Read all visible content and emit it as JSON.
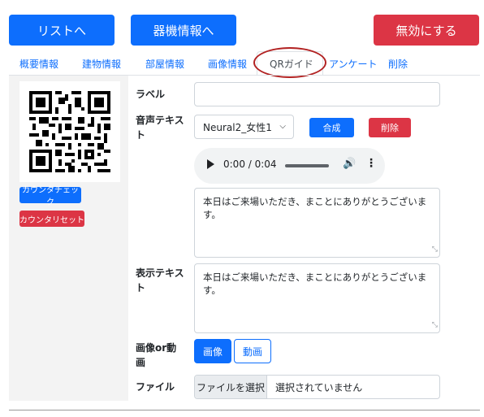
{
  "header": {
    "list_button": "リストへ",
    "device_button": "器機情報へ",
    "disable_button": "無効にする"
  },
  "tabs": [
    {
      "label": "概要情報"
    },
    {
      "label": "建物情報"
    },
    {
      "label": "部屋情報"
    },
    {
      "label": "画像情報"
    },
    {
      "label": "QRガイド",
      "active": true
    },
    {
      "label": "アンケート"
    },
    {
      "label": "削除"
    }
  ],
  "sidebar": {
    "qr_icon": "qr-code-icon",
    "count_check_button": "カウンタチェック",
    "count_reset_button": "カウンタリセット"
  },
  "form": {
    "label_field": {
      "label": "ラベル",
      "value": ""
    },
    "voice": {
      "label": "音声テキスト",
      "selected_voice": "Neural2_女性1",
      "synthesize_button": "合成",
      "delete_button": "削除",
      "text": "本日はご来場いただき、まことにありがとうございます。"
    },
    "audio": {
      "time": "0:00 / 0:04",
      "play_icon": "play-icon",
      "volume_icon": "volume-icon",
      "menu_icon": "more-vert-icon"
    },
    "display_text": {
      "label": "表示テキスト",
      "text": "本日はご来場いただき、まことにありがとうございます。"
    },
    "media_type": {
      "label": "画像or動画",
      "image_button": "画像",
      "video_button": "動画",
      "selected": "画像"
    },
    "file": {
      "label": "ファイル",
      "choose_button": "ファイルを選択",
      "status": "選択されていません"
    }
  },
  "colors": {
    "primary": "#0d6efd",
    "danger": "#dc3545",
    "annotation": "#b22222"
  }
}
